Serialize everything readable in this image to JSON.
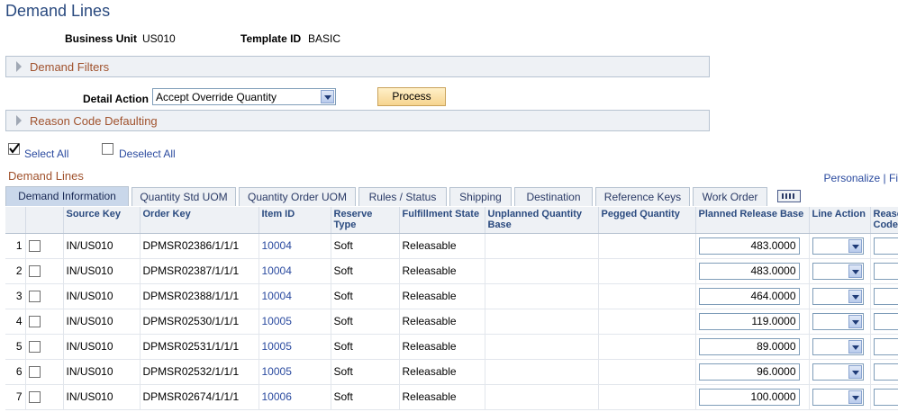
{
  "page": {
    "title": "Demand Lines"
  },
  "header": {
    "business_unit_label": "Business Unit",
    "business_unit_value": "US010",
    "template_id_label": "Template ID",
    "template_id_value": "BASIC"
  },
  "demand_filters": {
    "label": "Demand Filters"
  },
  "detail_action": {
    "label": "Detail Action",
    "value": "Accept Override Quantity",
    "process_label": "Process"
  },
  "reason_code_defaulting": {
    "label": "Reason Code Defaulting"
  },
  "selection": {
    "select_all": "Select All",
    "deselect_all": "Deselect All"
  },
  "grid": {
    "title": "Demand Lines",
    "personalize": "Personalize | Fi",
    "tabs": [
      "Demand Information",
      "Quantity Std UOM",
      "Quantity Order UOM",
      "Rules / Status",
      "Shipping",
      "Destination",
      "Reference Keys",
      "Work Order"
    ],
    "columns": {
      "source_key": "Source Key",
      "order_key": "Order Key",
      "item_id": "Item ID",
      "reserve_type": "Reserve Type",
      "fulfillment_state": "Fulfillment State",
      "unplanned_qty_base": "Unplanned Quantity Base",
      "pegged_qty": "Pegged Quantity",
      "planned_release_base": "Planned Release Base",
      "line_action": "Line Action",
      "reason_code": "Reaso Code"
    },
    "rows": [
      {
        "num": "1",
        "source_key": "IN/US010",
        "order_key": "DPMSR02386/1/1/1",
        "item_id": "10004",
        "reserve_type": "Soft",
        "fulfillment_state": "Releasable",
        "planned_release_base": "483.0000"
      },
      {
        "num": "2",
        "source_key": "IN/US010",
        "order_key": "DPMSR02387/1/1/1",
        "item_id": "10004",
        "reserve_type": "Soft",
        "fulfillment_state": "Releasable",
        "planned_release_base": "483.0000"
      },
      {
        "num": "3",
        "source_key": "IN/US010",
        "order_key": "DPMSR02388/1/1/1",
        "item_id": "10004",
        "reserve_type": "Soft",
        "fulfillment_state": "Releasable",
        "planned_release_base": "464.0000"
      },
      {
        "num": "4",
        "source_key": "IN/US010",
        "order_key": "DPMSR02530/1/1/1",
        "item_id": "10005",
        "reserve_type": "Soft",
        "fulfillment_state": "Releasable",
        "planned_release_base": "119.0000"
      },
      {
        "num": "5",
        "source_key": "IN/US010",
        "order_key": "DPMSR02531/1/1/1",
        "item_id": "10005",
        "reserve_type": "Soft",
        "fulfillment_state": "Releasable",
        "planned_release_base": "89.0000"
      },
      {
        "num": "6",
        "source_key": "IN/US010",
        "order_key": "DPMSR02532/1/1/1",
        "item_id": "10005",
        "reserve_type": "Soft",
        "fulfillment_state": "Releasable",
        "planned_release_base": "96.0000"
      },
      {
        "num": "7",
        "source_key": "IN/US010",
        "order_key": "DPMSR02674/1/1/1",
        "item_id": "10006",
        "reserve_type": "Soft",
        "fulfillment_state": "Releasable",
        "planned_release_base": "100.0000"
      }
    ]
  },
  "colors": {
    "title_blue": "#2a4a7f",
    "group_title": "#a0522d",
    "link_blue": "#2a4a9f"
  }
}
